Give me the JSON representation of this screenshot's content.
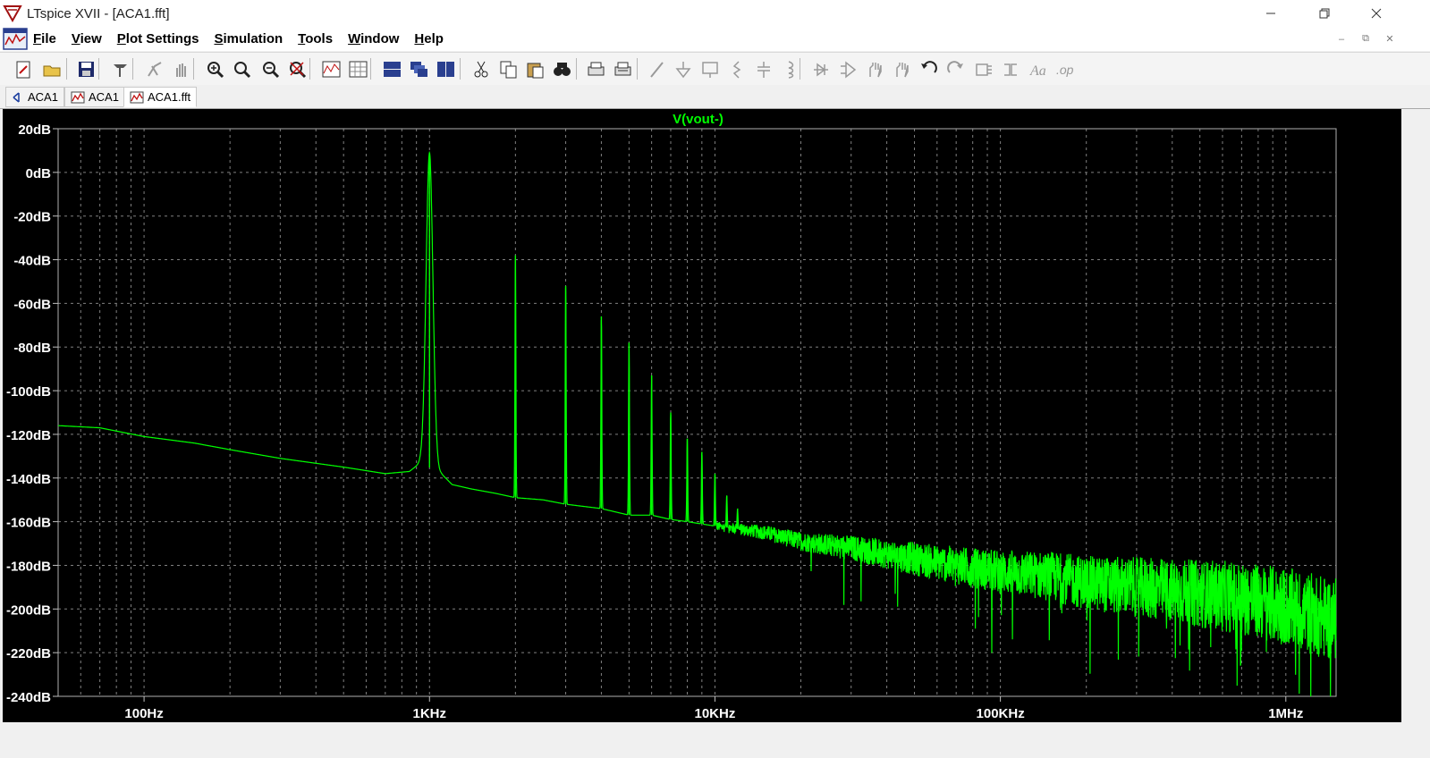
{
  "window": {
    "title": "LTspice XVII - [ACA1.fft]",
    "controls": [
      "minimize",
      "restore",
      "close"
    ]
  },
  "menubar": {
    "items": [
      {
        "accel": "F",
        "rest": "ile"
      },
      {
        "accel": "V",
        "rest": "iew"
      },
      {
        "accel": "P",
        "rest": "lot Settings"
      },
      {
        "accel": "S",
        "rest": "imulation"
      },
      {
        "accel": "T",
        "rest": "ools"
      },
      {
        "accel": "W",
        "rest": "indow"
      },
      {
        "accel": "H",
        "rest": "elp"
      }
    ]
  },
  "toolbar": {
    "buttons": [
      "new-schematic-icon",
      "open-folder-icon",
      "save-icon",
      "control-panel-icon",
      "run-icon",
      "halt-icon",
      "zoom-area-icon",
      "pan-icon",
      "zoom-out-icon",
      "zoom-full-icon",
      "autorange-icon",
      "grid-icon",
      "tile-horizontal-icon",
      "cascade-icon",
      "tile-vertical-icon",
      "cut-icon",
      "copy-icon",
      "paste-icon",
      "find-icon",
      "print-setup-icon",
      "print-icon",
      "wire-icon",
      "ground-icon",
      "label-icon",
      "resistor-icon",
      "capacitor-icon",
      "inductor-icon",
      "diode-icon",
      "component-icon",
      "move-icon",
      "drag-icon",
      "undo-icon",
      "redo-icon",
      "rotate-icon",
      "mirror-icon",
      "text-icon",
      "spice-directive-icon"
    ]
  },
  "tabs": [
    {
      "label": "ACA1",
      "icon": "schematic-icon",
      "active": false
    },
    {
      "label": "ACA1",
      "icon": "waveform-icon",
      "active": false
    },
    {
      "label": "ACA1.fft",
      "icon": "fft-waveform-icon",
      "active": true
    }
  ],
  "colors": {
    "plot_background": "#000000",
    "trace": "#00ff00",
    "grid": "#808080",
    "axis_text": "#ffffff",
    "trace_label": "#00ff00"
  },
  "chart_data": {
    "type": "line",
    "title": "V(vout-)",
    "xscale": "log",
    "xlim": [
      50,
      1500000
    ],
    "ylim": [
      -240,
      20
    ],
    "grid": true,
    "x_ticks": [
      {
        "value": 100,
        "label": "100Hz"
      },
      {
        "value": 1000,
        "label": "1KHz"
      },
      {
        "value": 10000,
        "label": "10KHz"
      },
      {
        "value": 100000,
        "label": "100KHz"
      },
      {
        "value": 1000000,
        "label": "1MHz"
      }
    ],
    "y_ticks": [
      {
        "value": 20,
        "label": "20dB"
      },
      {
        "value": 0,
        "label": "0dB"
      },
      {
        "value": -20,
        "label": "-20dB"
      },
      {
        "value": -40,
        "label": "-40dB"
      },
      {
        "value": -60,
        "label": "-60dB"
      },
      {
        "value": -80,
        "label": "-80dB"
      },
      {
        "value": -100,
        "label": "-100dB"
      },
      {
        "value": -120,
        "label": "-120dB"
      },
      {
        "value": -140,
        "label": "-140dB"
      },
      {
        "value": -160,
        "label": "-160dB"
      },
      {
        "value": -180,
        "label": "-180dB"
      },
      {
        "value": -200,
        "label": "-200dB"
      },
      {
        "value": -220,
        "label": "-220dB"
      },
      {
        "value": -240,
        "label": "-240dB"
      }
    ],
    "series": [
      {
        "name": "V(vout-)",
        "floor": [
          [
            50,
            -116
          ],
          [
            70,
            -117
          ],
          [
            100,
            -121
          ],
          [
            150,
            -124
          ],
          [
            200,
            -127
          ],
          [
            300,
            -131
          ],
          [
            500,
            -135
          ],
          [
            700,
            -138
          ],
          [
            850,
            -137
          ],
          [
            930,
            -133
          ],
          [
            1100,
            -138
          ],
          [
            1200,
            -143
          ],
          [
            1400,
            -145
          ],
          [
            1700,
            -147
          ],
          [
            2000,
            -149
          ],
          [
            2500,
            -150
          ],
          [
            3000,
            -152
          ],
          [
            4000,
            -154
          ],
          [
            5000,
            -157
          ],
          [
            6000,
            -157
          ],
          [
            7000,
            -159
          ],
          [
            8000,
            -160
          ],
          [
            10000,
            -162
          ],
          [
            15000,
            -165
          ],
          [
            20000,
            -169
          ],
          [
            30000,
            -172
          ],
          [
            50000,
            -177
          ],
          [
            70000,
            -180
          ],
          [
            100000,
            -183
          ],
          [
            150000,
            -185
          ],
          [
            200000,
            -188
          ],
          [
            300000,
            -190
          ],
          [
            500000,
            -193
          ],
          [
            700000,
            -195
          ],
          [
            1000000,
            -199
          ],
          [
            1200000,
            -202
          ],
          [
            1500000,
            -205
          ]
        ],
        "peaks": [
          {
            "f": 1000,
            "db": 9
          },
          {
            "f": 2000,
            "db": -38
          },
          {
            "f": 3000,
            "db": -52
          },
          {
            "f": 4000,
            "db": -66
          },
          {
            "f": 5000,
            "db": -78
          },
          {
            "f": 6000,
            "db": -93
          },
          {
            "f": 7000,
            "db": -110
          },
          {
            "f": 8000,
            "db": -122
          },
          {
            "f": 9000,
            "db": -128
          },
          {
            "f": 10000,
            "db": -138
          },
          {
            "f": 11000,
            "db": -148
          },
          {
            "f": 12000,
            "db": -154
          }
        ],
        "noise_start_hz": 10000,
        "noise_spread_db_at_1MHz": 16
      }
    ]
  }
}
